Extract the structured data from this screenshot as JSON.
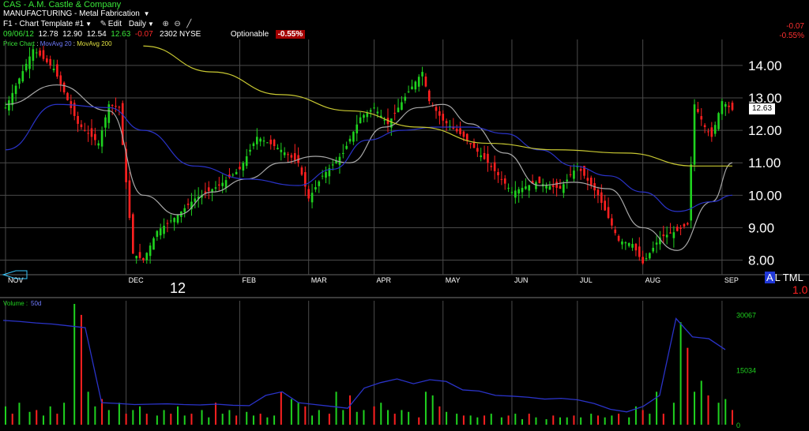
{
  "header": {
    "symbol": "CAS",
    "company": "A.M. Castle & Company",
    "sector": "MANUFACTURING",
    "industry": "Metal Fabrication",
    "template": "F1 - Chart Template #1",
    "edit_label": "Edit",
    "period": "Daily",
    "date": "09/06/12",
    "open": "12.78",
    "high": "12.90",
    "low": "12.54",
    "close": "12.63",
    "change": "-0.07",
    "volume": "2302",
    "exchange": "NYSE",
    "optionable": "Optionable",
    "change_pct": "-0.55%",
    "legend_price": "Price Chart",
    "legend_ma20": "MovAvg 20",
    "legend_ma200": "MovAvg 200",
    "volume_label": "Volume",
    "volume_ma": "50d"
  },
  "right_panel": {
    "change": "-0.07",
    "change_pct": "-0.55%",
    "price_tag": "12.63",
    "tml_a": "A",
    "tml_rest": "L TML",
    "tml_value": "1.0"
  },
  "year_label": "12",
  "colors": {
    "up": "#1fd21f",
    "down": "#ff2020",
    "ma_short": "#a8a8a8",
    "ma_mid": "#2a33c8",
    "ma_long": "#c8c832",
    "grid": "#4a4a4a"
  },
  "chart_data": {
    "type": "line",
    "x_labels": [
      "NOV",
      "DEC",
      "FEB",
      "MAR",
      "APR",
      "MAY",
      "JUN",
      "JUL",
      "AUG",
      "SEP"
    ],
    "y_ticks": [
      8.0,
      9.0,
      10.0,
      11.0,
      12.0,
      13.0,
      14.0
    ],
    "ylim": [
      7.6,
      14.8
    ],
    "price_series": [
      {
        "month": "NOV",
        "x": 0,
        "close": 12.7
      },
      {
        "month": "",
        "x": 8,
        "close": 14.5
      },
      {
        "month": "",
        "x": 14,
        "close": 13.9
      },
      {
        "month": "",
        "x": 21,
        "close": 12.2
      },
      {
        "month": "",
        "x": 27,
        "close": 11.6
      },
      {
        "month": "",
        "x": 30,
        "close": 12.8
      },
      {
        "month": "",
        "x": 33,
        "close": 12.7
      },
      {
        "month": "DEC",
        "x": 35,
        "close": 10.4
      },
      {
        "month": "",
        "x": 37,
        "close": 8.2
      },
      {
        "month": "",
        "x": 40,
        "close": 8.0
      },
      {
        "month": "",
        "x": 44,
        "close": 8.9
      },
      {
        "month": "",
        "x": 49,
        "close": 9.3
      },
      {
        "month": "",
        "x": 55,
        "close": 9.9
      },
      {
        "month": "",
        "x": 62,
        "close": 10.3
      },
      {
        "month": "FEB",
        "x": 68,
        "close": 10.8
      },
      {
        "month": "",
        "x": 73,
        "close": 11.8
      },
      {
        "month": "",
        "x": 80,
        "close": 11.4
      },
      {
        "month": "",
        "x": 85,
        "close": 11.0
      },
      {
        "month": "MAR",
        "x": 88,
        "close": 9.9
      },
      {
        "month": "",
        "x": 92,
        "close": 10.6
      },
      {
        "month": "",
        "x": 98,
        "close": 11.3
      },
      {
        "month": "",
        "x": 103,
        "close": 12.4
      },
      {
        "month": "APR",
        "x": 107,
        "close": 12.7
      },
      {
        "month": "",
        "x": 111,
        "close": 12.2
      },
      {
        "month": "",
        "x": 117,
        "close": 13.2
      },
      {
        "month": "",
        "x": 121,
        "close": 13.8
      },
      {
        "month": "",
        "x": 123,
        "close": 12.9
      },
      {
        "month": "MAY",
        "x": 127,
        "close": 12.3
      },
      {
        "month": "",
        "x": 133,
        "close": 11.8
      },
      {
        "month": "",
        "x": 140,
        "close": 11.0
      },
      {
        "month": "JUN",
        "x": 147,
        "close": 10.1
      },
      {
        "month": "",
        "x": 154,
        "close": 10.4
      },
      {
        "month": "",
        "x": 161,
        "close": 10.2
      },
      {
        "month": "JUL",
        "x": 166,
        "close": 10.9
      },
      {
        "month": "",
        "x": 172,
        "close": 10.0
      },
      {
        "month": "",
        "x": 178,
        "close": 8.6
      },
      {
        "month": "",
        "x": 182,
        "close": 8.5
      },
      {
        "month": "AUG",
        "x": 185,
        "close": 7.9
      },
      {
        "month": "",
        "x": 190,
        "close": 8.7
      },
      {
        "month": "",
        "x": 195,
        "close": 8.9
      },
      {
        "month": "",
        "x": 198,
        "close": 9.1
      },
      {
        "month": "",
        "x": 200,
        "close": 12.8
      },
      {
        "month": "",
        "x": 203,
        "close": 12.1
      },
      {
        "month": "",
        "x": 205,
        "close": 11.8
      },
      {
        "month": "SEP",
        "x": 208,
        "close": 12.9
      },
      {
        "month": "",
        "x": 211,
        "close": 12.63
      }
    ],
    "series": [
      {
        "name": "MovAvg 20",
        "values_at": [
          0,
          15,
          30,
          40,
          50,
          60,
          70,
          80,
          90,
          100,
          110,
          120,
          127,
          135,
          145,
          155,
          165,
          175,
          185,
          195,
          205,
          211
        ],
        "values": [
          12.8,
          13.4,
          12.6,
          10.0,
          9.4,
          10.1,
          10.5,
          11.0,
          11.2,
          11.0,
          12.1,
          12.7,
          12.8,
          12.2,
          11.3,
          10.3,
          10.4,
          10.2,
          9.0,
          8.3,
          9.8,
          11.0
        ]
      },
      {
        "name": "",
        "values_at": [
          0,
          15,
          30,
          40,
          55,
          70,
          85,
          95,
          105,
          115,
          125,
          135,
          145,
          155,
          165,
          175,
          185,
          195,
          205,
          211
        ],
        "values": [
          11.4,
          12.8,
          12.7,
          12.0,
          10.9,
          10.5,
          10.3,
          10.8,
          11.7,
          12.0,
          12.1,
          12.1,
          11.9,
          11.4,
          10.9,
          10.6,
          10.1,
          9.5,
          9.8,
          10.0
        ]
      },
      {
        "name": "MovAvg 200",
        "values_at": [
          40,
          60,
          80,
          100,
          120,
          140,
          160,
          180,
          200,
          211
        ],
        "values": [
          14.6,
          13.8,
          13.1,
          12.6,
          12.1,
          11.6,
          11.4,
          11.3,
          10.9,
          10.9
        ]
      }
    ],
    "volume": {
      "y_ticks": [
        15034,
        30067
      ],
      "ylim": [
        0,
        33000
      ],
      "bars": [
        5000,
        3000,
        6000,
        3500,
        4000,
        2500,
        5000,
        3000,
        6000,
        33000,
        30000,
        9000,
        5000,
        7000,
        4000,
        6000,
        3000,
        4000,
        5000,
        3000,
        2500,
        4000,
        3000,
        5000,
        2500,
        3000,
        4000,
        2000,
        6000,
        3000,
        4000,
        2500,
        3500,
        2500,
        3000,
        2000,
        2500,
        9000,
        7000,
        6000,
        5000,
        2500,
        4000,
        3000,
        9000,
        4000,
        8000,
        3500,
        4000,
        5000,
        6000,
        4000,
        3000,
        4000,
        3500,
        2000,
        9000,
        8000,
        5000,
        3500,
        3000,
        2500,
        2500,
        2000,
        2500,
        3000,
        2000,
        2500,
        3000,
        1500,
        3000,
        2000,
        1500,
        2500,
        2000,
        2000,
        2500,
        2000,
        3000,
        2500,
        2000,
        2500,
        3000,
        2000,
        5000,
        4000,
        3000,
        9000,
        3000,
        6000,
        28000,
        21000,
        9000,
        12000,
        8000,
        6000,
        7000,
        4000
      ],
      "ma_values": [
        28500,
        28200,
        27800,
        27500,
        27000,
        26500,
        6000,
        5800,
        5500,
        5600,
        5700,
        5500,
        5400,
        5600,
        5300,
        5200,
        8000,
        9000,
        6000,
        5500,
        5000,
        4500,
        10000,
        11500,
        12500,
        11200,
        12300,
        11800,
        9500,
        9200,
        8000,
        7800,
        7500,
        7000,
        7200,
        6800,
        5800,
        4200,
        3500,
        5000,
        8000,
        29000,
        24000,
        23500,
        20500
      ]
    }
  }
}
